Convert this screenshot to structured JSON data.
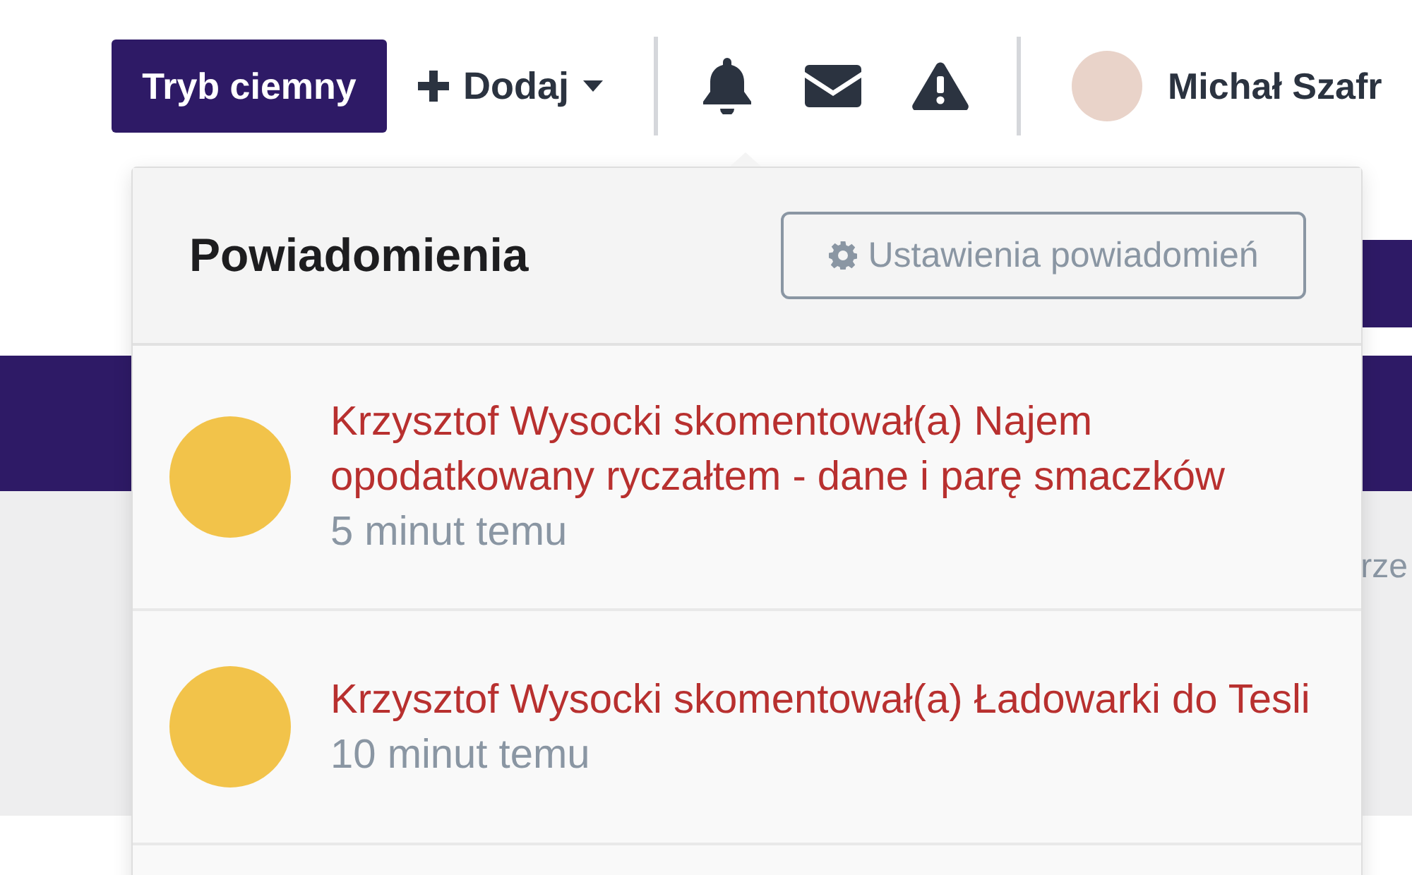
{
  "top_bar": {
    "dark_mode_button": "Tryb ciemny",
    "add_menu": "Dodaj",
    "user_name": "Michał Szafr"
  },
  "background": {
    "partial_text": "rze"
  },
  "notifications": {
    "title": "Powiadomienia",
    "settings_button": "Ustawienia powiadomień",
    "items": [
      {
        "text": "Krzysztof Wysocki skomentował(a) Najem opodatkowany ryczałtem - dane i parę smaczków",
        "time": "5 minut temu"
      },
      {
        "text": "Krzysztof Wysocki skomentował(a) Ładowarki do Tesli",
        "time": "10 minut temu"
      }
    ]
  }
}
